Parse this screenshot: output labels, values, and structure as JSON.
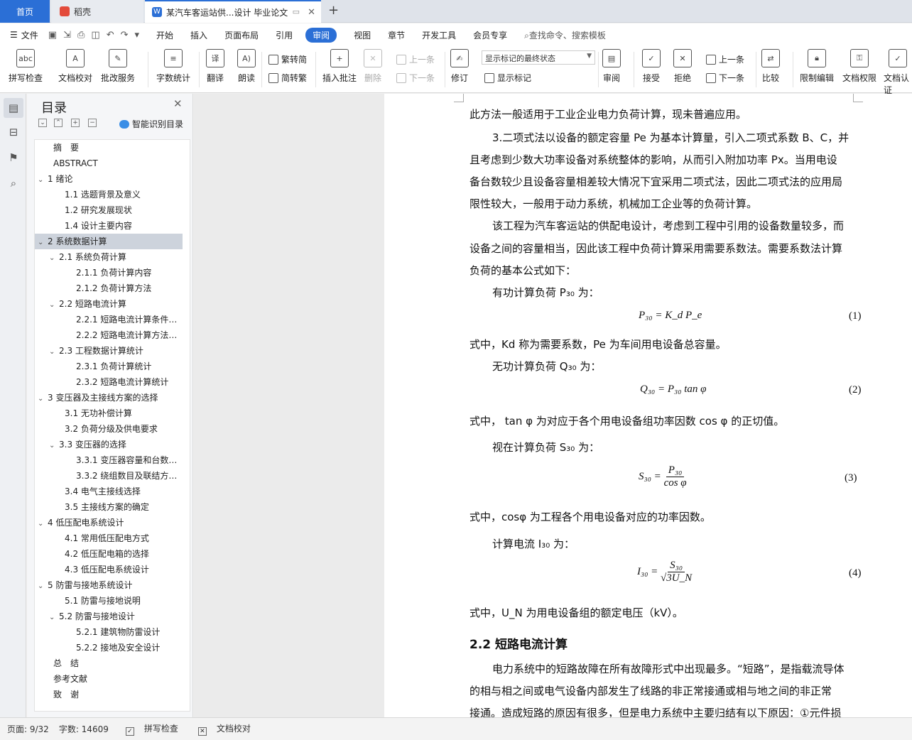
{
  "tabs": {
    "home": "首页",
    "daoke": "稻壳",
    "doc": "某汽车客运站供...设计 毕业论文"
  },
  "menu": {
    "file": "文件",
    "items": [
      "开始",
      "插入",
      "页面布局",
      "引用",
      "审阅",
      "视图",
      "章节",
      "开发工具",
      "会员专享"
    ],
    "active": "审阅",
    "search": "查找命令、搜索模板"
  },
  "ribbon": {
    "spellcheck": "拼写检查",
    "doccheck": "文档校对",
    "batch": "批改服务",
    "wordcount": "字数统计",
    "translate": "翻译",
    "read": "朗读",
    "trad": "繁转简",
    "simp": "简转繁",
    "insert_comment": "插入批注",
    "delete": "删除",
    "prev_comment": "上一条",
    "next_comment": "下一条",
    "track": "修订",
    "mark_state": "显示标记的最终状态",
    "show_mark": "显示标记",
    "review": "审阅",
    "accept": "接受",
    "reject": "拒绝",
    "prev": "上一条",
    "next": "下一条",
    "compare": "比较",
    "restrict": "限制编辑",
    "perm": "文档权限",
    "cert": "文档认证"
  },
  "toc": {
    "title": "目录",
    "smart": "智能识别目录",
    "items": [
      {
        "t": "摘　要",
        "lv": 0,
        "ch": ""
      },
      {
        "t": "ABSTRACT",
        "lv": 0,
        "ch": ""
      },
      {
        "t": "1  绪论",
        "lv": 0,
        "ch": "v"
      },
      {
        "t": "1.1  选题背景及意义",
        "lv": 1,
        "ch": ""
      },
      {
        "t": "1.2  研究发展现状",
        "lv": 1,
        "ch": ""
      },
      {
        "t": "1.4  设计主要内容",
        "lv": 1,
        "ch": ""
      },
      {
        "t": "2  系统数据计算",
        "lv": 0,
        "ch": "v",
        "sel": true
      },
      {
        "t": "2.1  系统负荷计算",
        "lv": 1,
        "ch": "v"
      },
      {
        "t": "2.1.1  负荷计算内容",
        "lv": 2,
        "ch": ""
      },
      {
        "t": "2.1.2  负荷计算方法",
        "lv": 2,
        "ch": ""
      },
      {
        "t": "2.2  短路电流计算",
        "lv": 1,
        "ch": "v"
      },
      {
        "t": "2.2.1  短路电流计算条件及...",
        "lv": 2,
        "ch": ""
      },
      {
        "t": "2.2.2  短路电流计算方法及...",
        "lv": 2,
        "ch": ""
      },
      {
        "t": "2.3  工程数据计算统计",
        "lv": 1,
        "ch": "v"
      },
      {
        "t": "2.3.1  负荷计算统计",
        "lv": 2,
        "ch": ""
      },
      {
        "t": "2.3.2  短路电流计算统计",
        "lv": 2,
        "ch": ""
      },
      {
        "t": "3  变压器及主接线方案的选择",
        "lv": 0,
        "ch": "v"
      },
      {
        "t": "3.1  无功补偿计算",
        "lv": 1,
        "ch": ""
      },
      {
        "t": "3.2  负荷分级及供电要求",
        "lv": 1,
        "ch": ""
      },
      {
        "t": "3.3  变压器的选择",
        "lv": 1,
        "ch": "v"
      },
      {
        "t": "3.3.1  变压器容量和台数的...",
        "lv": 2,
        "ch": ""
      },
      {
        "t": "3.3.2  绕组数目及联结方式...",
        "lv": 2,
        "ch": ""
      },
      {
        "t": "3.4  电气主接线选择",
        "lv": 1,
        "ch": ""
      },
      {
        "t": "3.5  主接线方案的确定",
        "lv": 1,
        "ch": ""
      },
      {
        "t": "4  低压配电系统设计",
        "lv": 0,
        "ch": "v"
      },
      {
        "t": "4.1  常用低压配电方式",
        "lv": 1,
        "ch": ""
      },
      {
        "t": "4.2  低压配电箱的选择",
        "lv": 1,
        "ch": ""
      },
      {
        "t": "4.3  低压配电系统设计",
        "lv": 1,
        "ch": ""
      },
      {
        "t": "5  防雷与接地系统设计",
        "lv": 0,
        "ch": "v"
      },
      {
        "t": "5.1  防雷与接地说明",
        "lv": 1,
        "ch": ""
      },
      {
        "t": "5.2  防雷与接地设计",
        "lv": 1,
        "ch": "v"
      },
      {
        "t": "5.2.1  建筑物防雷设计",
        "lv": 2,
        "ch": ""
      },
      {
        "t": "5.2.2  接地及安全设计",
        "lv": 2,
        "ch": ""
      },
      {
        "t": "总　结",
        "lv": 0,
        "ch": ""
      },
      {
        "t": "参考文献",
        "lv": 0,
        "ch": ""
      },
      {
        "t": "致　谢",
        "lv": 0,
        "ch": ""
      }
    ]
  },
  "doc": {
    "l1": "此方法一般适用于工业企业电力负荷计算，现未普遍应用。",
    "l2": "3.二项式法以设备的额定容量 Pe 为基本计算量，引入二项式系数 B、C，并",
    "l3": "且考虑到少数大功率设备对系统整体的影响，从而引入附加功率 Px。当用电设",
    "l4": "备台数较少且设备容量相差较大情况下宜采用二项式法，因此二项式法的应用局",
    "l5": "限性较大，一般用于动力系统，机械加工企业等的负荷计算。",
    "l6": "该工程为汽车客运站的供配电设计，考虑到工程中引用的设备数量较多，而",
    "l7": "设备之间的容量相当，因此该工程中负荷计算采用需要系数法。需要系数法计算",
    "l8": "负荷的基本公式如下：",
    "l9": "有功计算负荷 P₃₀ 为：",
    "eq1": "P₃₀ = K_d P_e",
    "eq1n": "(1)",
    "l10": "式中，Kd 称为需要系数，Pe 为车间用电设备总容量。",
    "l11": "无功计算负荷 Q₃₀ 为：",
    "eq2": "Q₃₀ = P₃₀ tan φ",
    "eq2n": "(2)",
    "l12": "式中， tan φ 为对应于各个用电设备组功率因数 cos φ 的正切值。",
    "l13": "视在计算负荷 S₃₀ 为：",
    "eq3_lhs": "S₃₀ =",
    "eq3_num": "P₃₀",
    "eq3_den": "cos φ",
    "eq3n": "(3)",
    "l14": "式中，cosφ 为工程各个用电设备对应的功率因数。",
    "l15": "计算电流 I₃₀ 为：",
    "eq4_lhs": "I₃₀ =",
    "eq4_num": "S₃₀",
    "eq4_den": "√3U_N",
    "eq4n": "(4)",
    "l16": "式中，U_N 为用电设备组的额定电压（kV）。",
    "h2": "2.2  短路电流计算",
    "l17": "电力系统中的短路故障在所有故障形式中出现最多。“短路”，是指载流导体",
    "l18": "的相与相之间或电气设备内部发生了线路的非正常接通或相与地之间的非正常",
    "l19": "接通。造成短路的原因有很多，但是电力系统中主要归结有以下原因：①元件损"
  },
  "status": {
    "page": "页面: 9/32",
    "words": "字数: 14609",
    "spell": "拼写检查",
    "check": "文档校对"
  }
}
